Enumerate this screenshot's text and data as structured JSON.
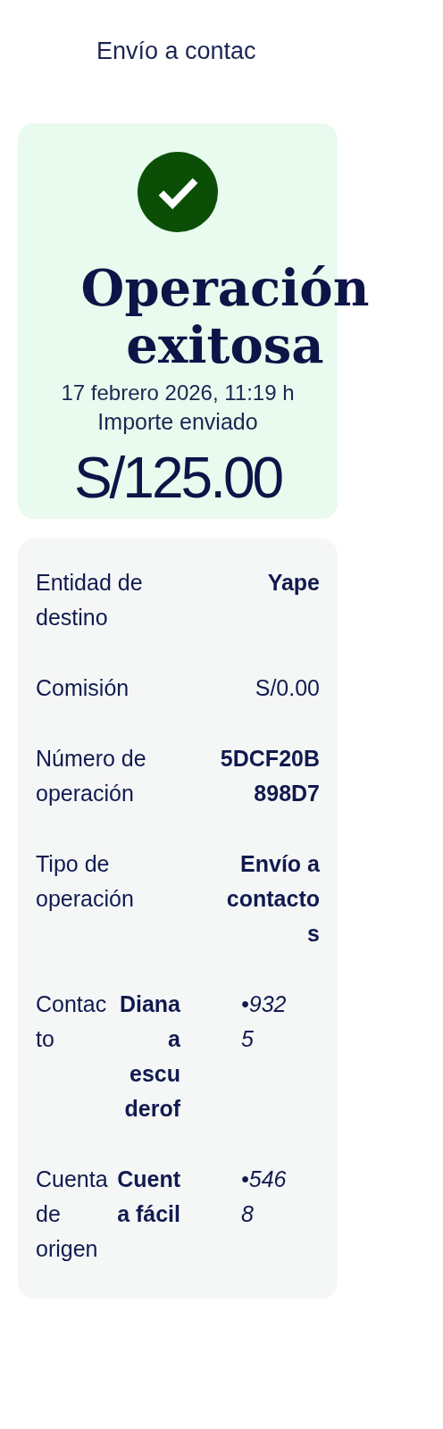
{
  "header": {
    "title": "Envío a contac"
  },
  "result": {
    "title": "Operación exitosa",
    "date": "17 febrero 2026, 11:19 h",
    "amount_label": "Importe enviado",
    "amount": "S/125.00"
  },
  "details": [
    {
      "kind": "pair",
      "label": "Entidad de destino",
      "value": "Yape",
      "bold": true
    },
    {
      "kind": "pair",
      "label": "Comisión",
      "value": "S/0.00",
      "bold": false
    },
    {
      "kind": "pair",
      "label": "Número de operación",
      "value": "5DCF20B898D7",
      "bold": true
    },
    {
      "kind": "pair",
      "label": "Tipo de operación",
      "value": "Envío a contactos",
      "bold": true
    },
    {
      "kind": "triple",
      "label": "Contacto",
      "value": "Dianaa escuderof",
      "masked": "•9325"
    },
    {
      "kind": "triple",
      "label": "Cuenta de origen",
      "value": "Cuenta fácil",
      "masked": "•5468"
    }
  ]
}
